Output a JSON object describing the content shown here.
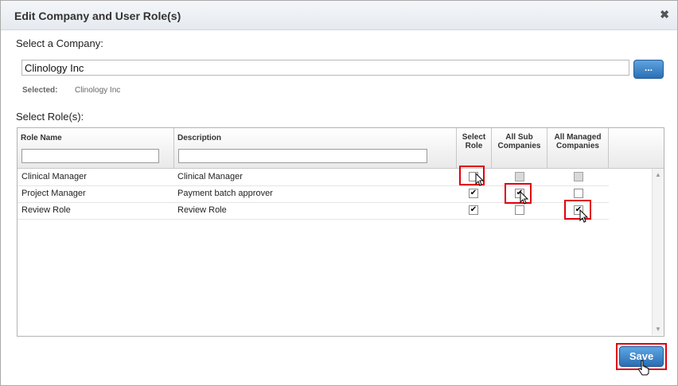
{
  "dialog": {
    "title": "Edit Company and User Role(s)",
    "close_icon": "close-icon"
  },
  "company": {
    "label": "Select a Company:",
    "value": "Clinology Inc",
    "browse_label": "...",
    "selected_label": "Selected:",
    "selected_value": "Clinology Inc"
  },
  "roles": {
    "label": "Select Role(s):",
    "columns": {
      "role_name": "Role Name",
      "description": "Description",
      "select_role": [
        "Select",
        "Role"
      ],
      "all_sub": [
        "All Sub",
        "Companies"
      ],
      "all_managed": [
        "All Managed",
        "Companies"
      ]
    },
    "rows": [
      {
        "role_name": "Clinical Manager",
        "description": "Clinical Manager",
        "select_role": false,
        "all_sub": false,
        "all_managed": false
      },
      {
        "role_name": "Project Manager",
        "description": "Payment batch approver",
        "select_role": true,
        "all_sub": true,
        "all_managed": false
      },
      {
        "role_name": "Review Role",
        "description": "Review Role",
        "select_role": true,
        "all_sub": false,
        "all_managed": true
      }
    ]
  },
  "footer": {
    "save_label": "Save"
  },
  "colors": {
    "highlight": "#e0000c",
    "button": "#2c6fb5"
  }
}
